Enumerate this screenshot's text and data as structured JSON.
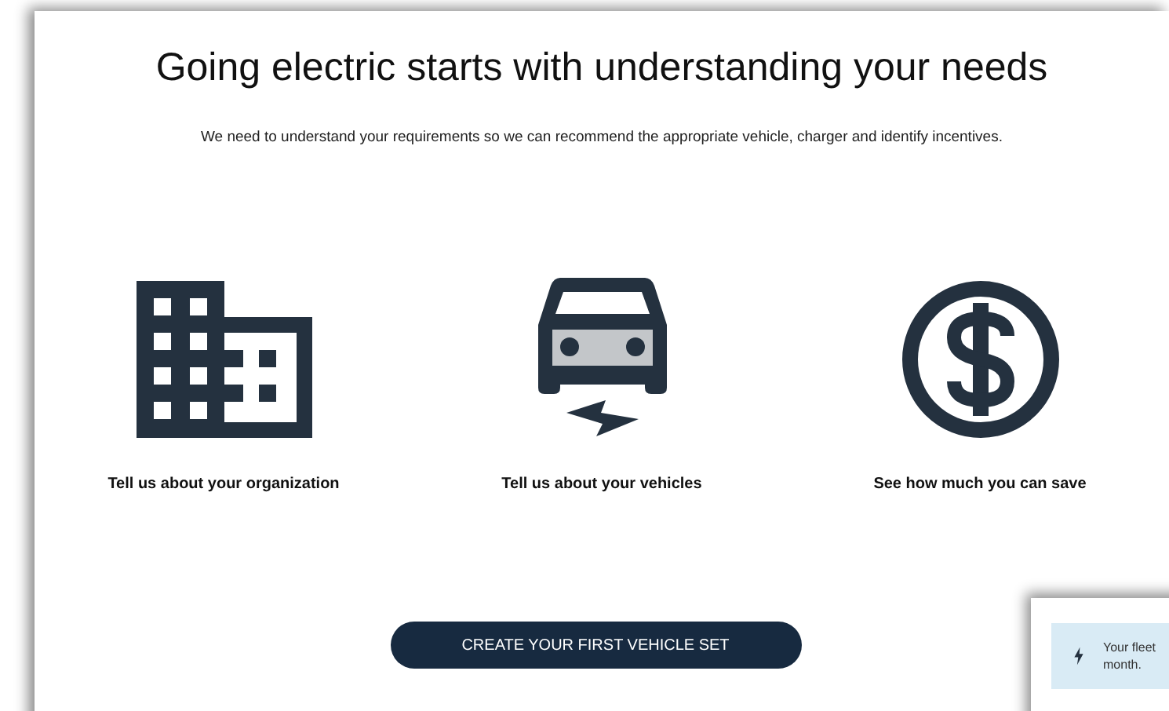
{
  "heading": "Going electric starts with understanding your needs",
  "intro": "We need to understand your requirements so we can recommend the appropriate vehicle, charger and identify incentives.",
  "steps": [
    {
      "kind": "building",
      "label": "Tell us about your organization"
    },
    {
      "kind": "car",
      "label": "Tell us about your vehicles"
    },
    {
      "kind": "dollar",
      "label": "See how much you can save"
    }
  ],
  "cta": "CREATE YOUR FIRST VEHICLE SET",
  "notice": {
    "lines": [
      "Your fleet",
      "month."
    ]
  }
}
